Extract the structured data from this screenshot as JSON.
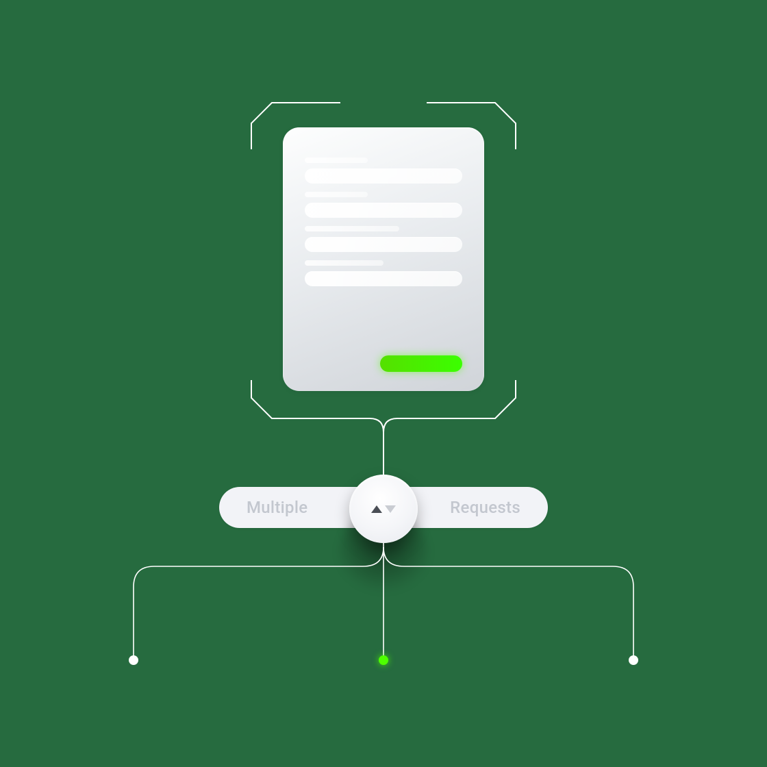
{
  "pill": {
    "left_label": "Multiple",
    "right_label": "Requests"
  },
  "icons": {
    "knob": "sort-toggle-icon"
  },
  "colors": {
    "accent_green": "#4eff00",
    "background": "#266b3f",
    "pill_bg": "#f2f3f7",
    "text_muted": "#c3c7cf"
  },
  "diagram": {
    "endpoints": [
      {
        "active": false
      },
      {
        "active": true
      },
      {
        "active": false
      }
    ]
  }
}
